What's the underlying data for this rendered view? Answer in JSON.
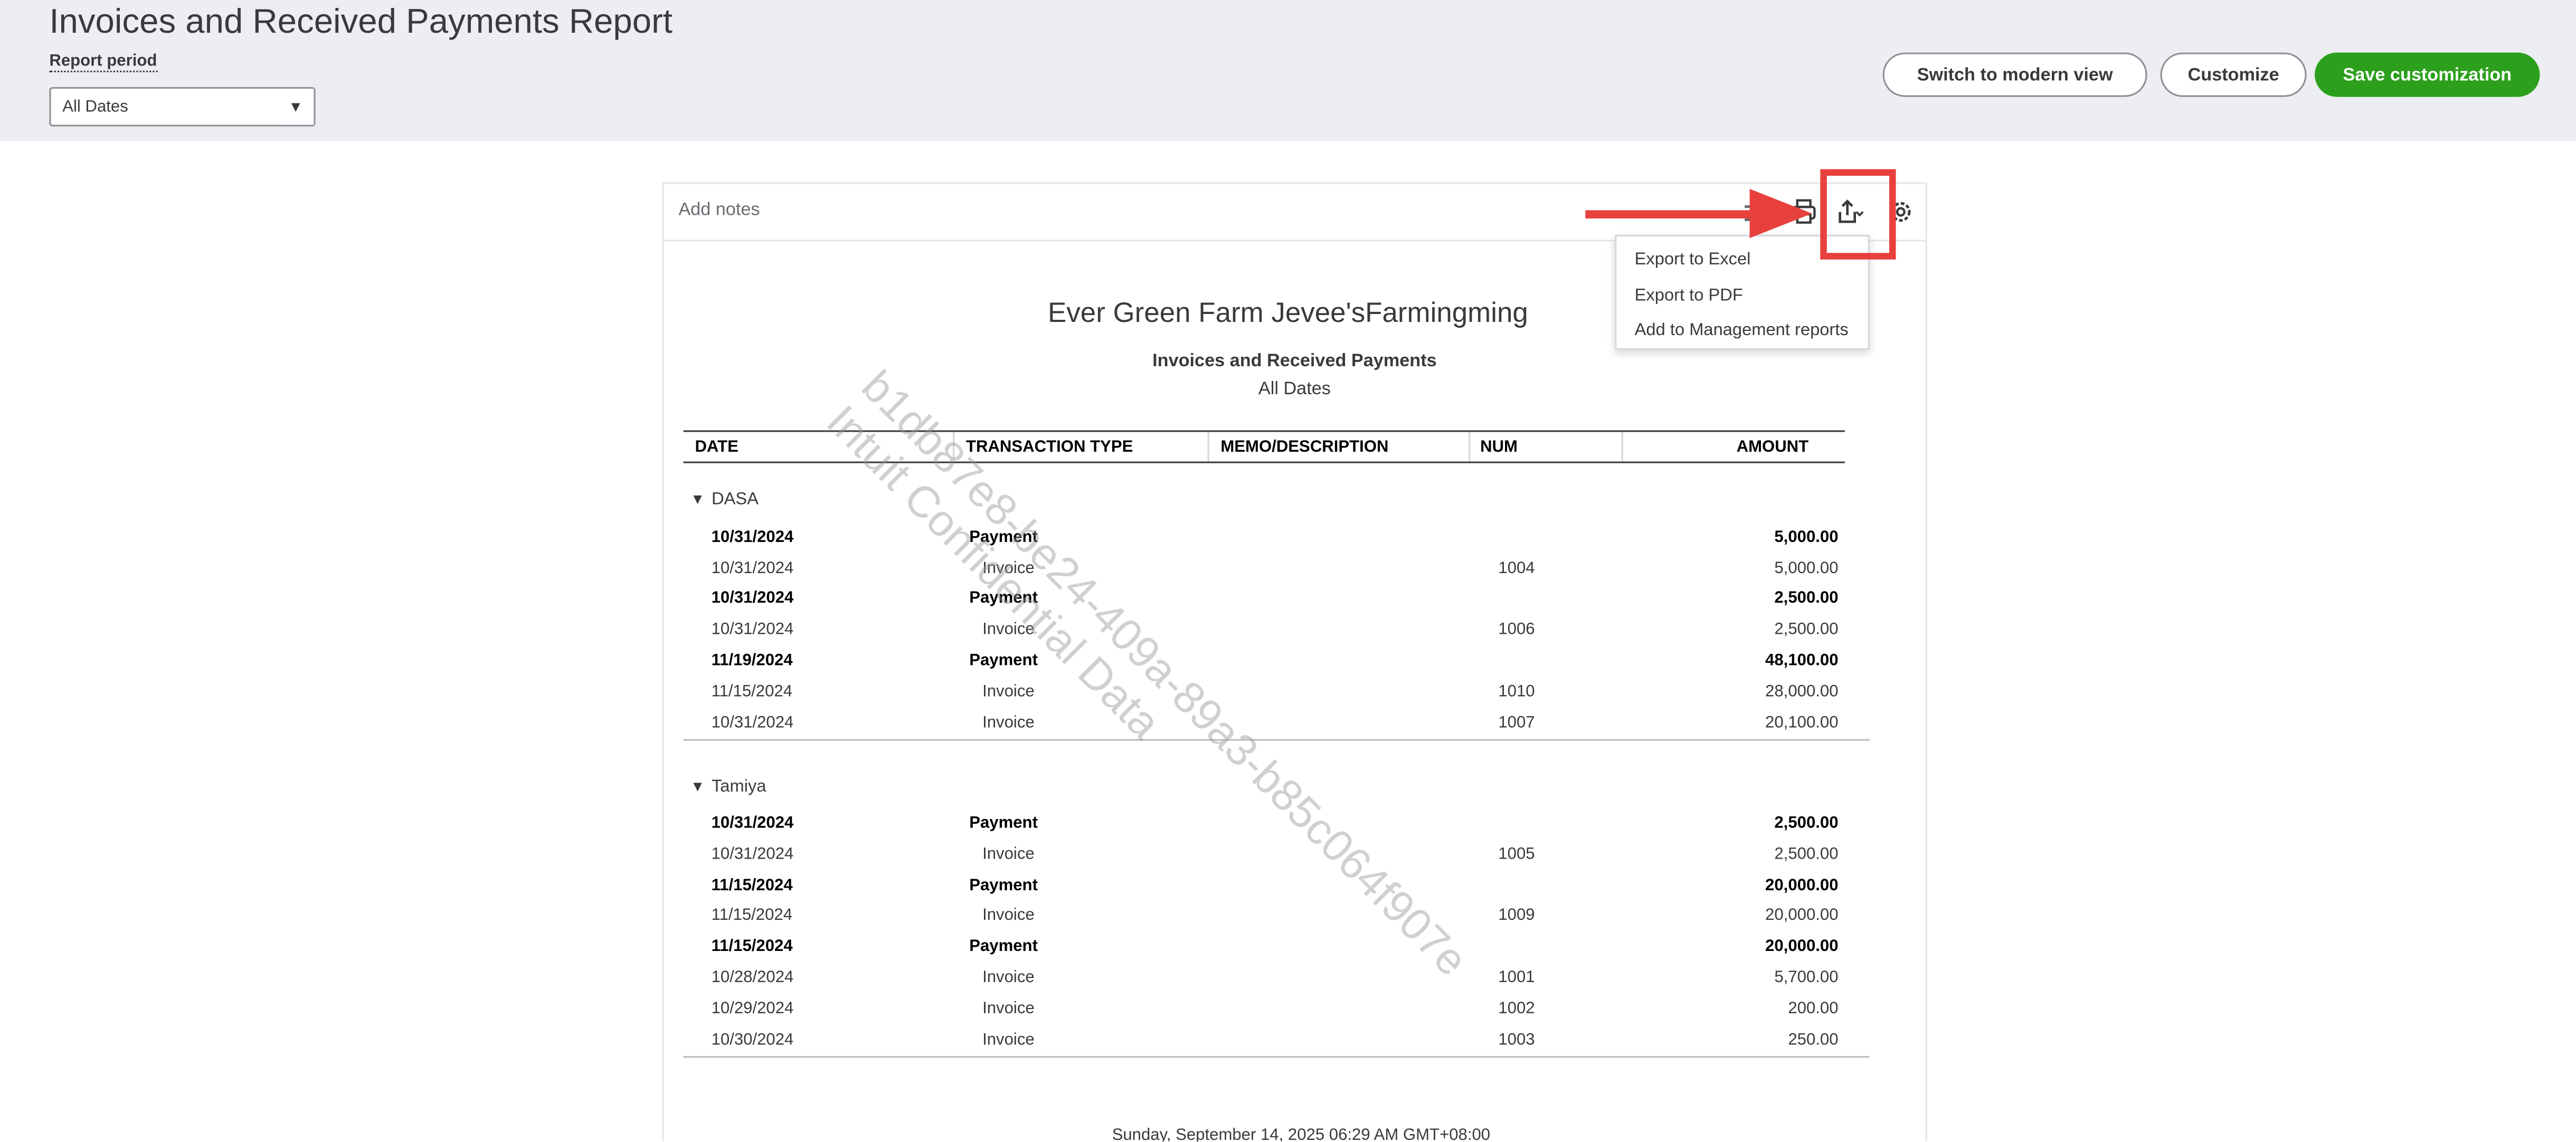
{
  "header": {
    "title": "Invoices and Received Payments Report",
    "period_label": "Report period",
    "period_value": "All Dates",
    "period_caret": "▼",
    "buttons": {
      "modern": "Switch to modern view",
      "customize": "Customize",
      "save": "Save customization"
    }
  },
  "toolbar": {
    "add_notes": "Add notes",
    "icons": [
      "sort-icon",
      "print-icon",
      "export-icon",
      "settings-icon"
    ]
  },
  "export_menu": {
    "items": [
      "Export to Excel",
      "Export to PDF",
      "Add to Management reports"
    ]
  },
  "report": {
    "company": "Ever Green Farm Jevee'sFarmingming",
    "title": "Invoices and Received Payments",
    "subtitle": "All Dates",
    "columns": {
      "date": "DATE",
      "type": "TRANSACTION TYPE",
      "memo": "MEMO/DESCRIPTION",
      "num": "NUM",
      "amount": "AMOUNT"
    },
    "groups": [
      {
        "name": "DASA",
        "caret": "▾",
        "rows": [
          {
            "date": "10/31/2024",
            "type": "Payment",
            "num": "",
            "amount": "5,000.00",
            "bold": true
          },
          {
            "date": "10/31/2024",
            "type": "Invoice",
            "num": "1004",
            "amount": "5,000.00",
            "bold": false
          },
          {
            "date": "10/31/2024",
            "type": "Payment",
            "num": "",
            "amount": "2,500.00",
            "bold": true
          },
          {
            "date": "10/31/2024",
            "type": "Invoice",
            "num": "1006",
            "amount": "2,500.00",
            "bold": false
          },
          {
            "date": "11/19/2024",
            "type": "Payment",
            "num": "",
            "amount": "48,100.00",
            "bold": true
          },
          {
            "date": "11/15/2024",
            "type": "Invoice",
            "num": "1010",
            "amount": "28,000.00",
            "bold": false
          },
          {
            "date": "10/31/2024",
            "type": "Invoice",
            "num": "1007",
            "amount": "20,100.00",
            "bold": false
          }
        ]
      },
      {
        "name": "Tamiya",
        "caret": "▾",
        "rows": [
          {
            "date": "10/31/2024",
            "type": "Payment",
            "num": "",
            "amount": "2,500.00",
            "bold": true
          },
          {
            "date": "10/31/2024",
            "type": "Invoice",
            "num": "1005",
            "amount": "2,500.00",
            "bold": false
          },
          {
            "date": "11/15/2024",
            "type": "Payment",
            "num": "",
            "amount": "20,000.00",
            "bold": true
          },
          {
            "date": "11/15/2024",
            "type": "Invoice",
            "num": "1009",
            "amount": "20,000.00",
            "bold": false
          },
          {
            "date": "11/15/2024",
            "type": "Payment",
            "num": "",
            "amount": "20,000.00",
            "bold": true
          },
          {
            "date": "10/28/2024",
            "type": "Invoice",
            "num": "1001",
            "amount": "5,700.00",
            "bold": false
          },
          {
            "date": "10/29/2024",
            "type": "Invoice",
            "num": "1002",
            "amount": "200.00",
            "bold": false
          },
          {
            "date": "10/30/2024",
            "type": "Invoice",
            "num": "1003",
            "amount": "250.00",
            "bold": false
          }
        ]
      }
    ],
    "footer": "Sunday, September 14, 2025 06:29 AM GMT+08:00"
  },
  "watermark": {
    "line1": "b1db87e8-be24-409a-89a3-b85c064f907e",
    "line2": "Intuit Confidential Data"
  },
  "colors": {
    "accent_green": "#2ca01c",
    "annotation_red": "#e8403c",
    "header_bg": "#eceef1"
  }
}
